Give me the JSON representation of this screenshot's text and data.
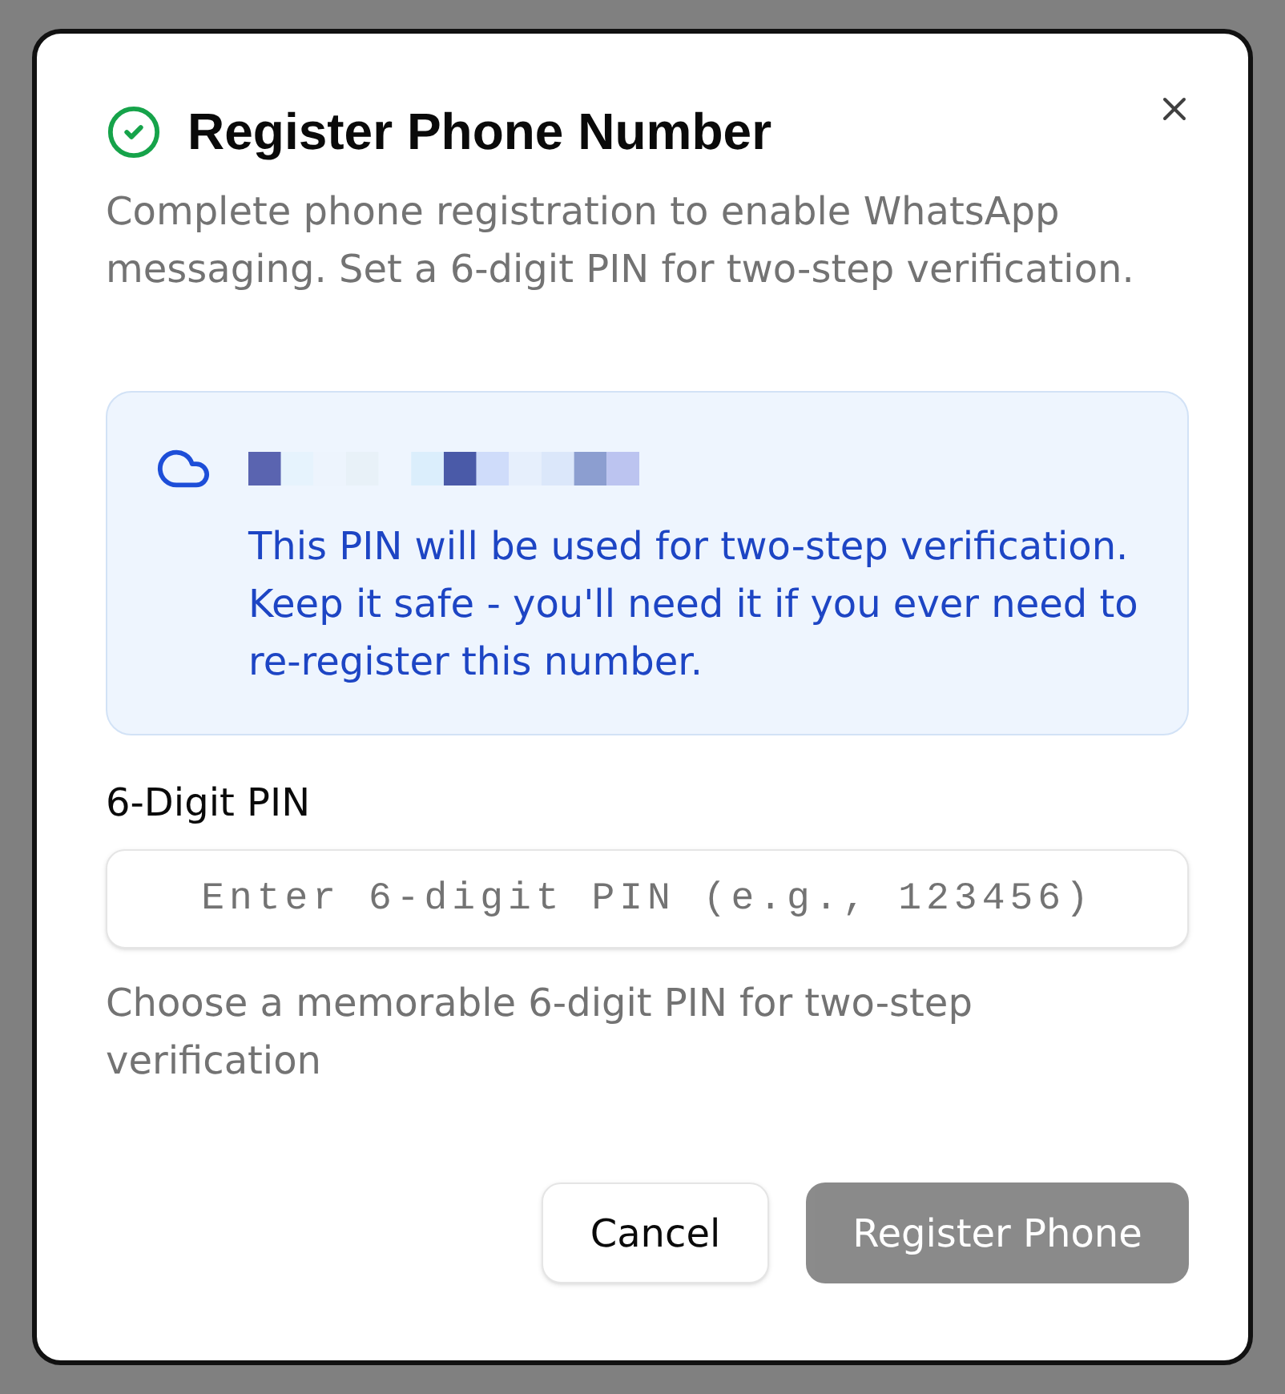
{
  "dialog": {
    "title": "Register Phone Number",
    "description": "Complete phone registration to enable WhatsApp messaging. Set a 6-digit PIN for two-step verification."
  },
  "info_box": {
    "message": "This PIN will be used for two-step verification. Keep it safe - you'll need it if you ever need to re-register this number."
  },
  "pin_field": {
    "label": "6-Digit PIN",
    "placeholder": "Enter 6-digit PIN (e.g., 123456)",
    "hint": "Choose a memorable 6-digit PIN for two-step verification"
  },
  "buttons": [
    {
      "label": "Cancel",
      "kind": "secondary",
      "disabled": false
    },
    {
      "label": "Register Phone",
      "kind": "primary",
      "disabled": true
    }
  ]
}
